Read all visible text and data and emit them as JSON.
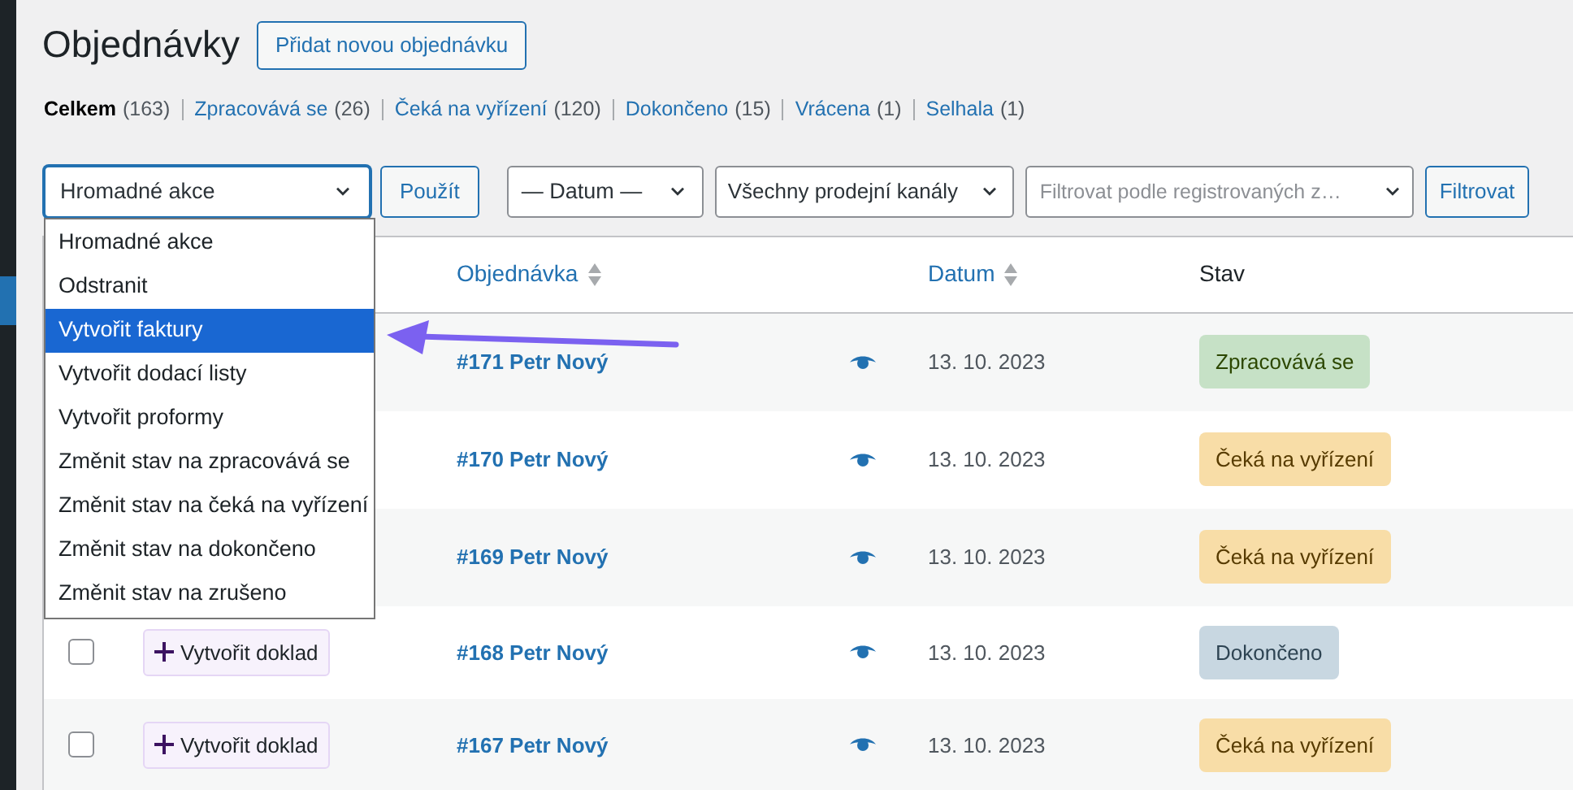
{
  "page": {
    "title": "Objednávky",
    "add_button": "Přidat novou objednávku"
  },
  "status_filters": [
    {
      "label": "Celkem",
      "count": "(163)",
      "selected": true
    },
    {
      "label": "Zpracovává se",
      "count": "(26)",
      "selected": false
    },
    {
      "label": "Čeká na vyřízení",
      "count": "(120)",
      "selected": false
    },
    {
      "label": "Dokončeno",
      "count": "(15)",
      "selected": false
    },
    {
      "label": "Vrácena",
      "count": "(1)",
      "selected": false
    },
    {
      "label": "Selhala",
      "count": "(1)",
      "selected": false
    }
  ],
  "toolbar": {
    "bulk_select": "Hromadné akce",
    "apply": "Použít",
    "date_select": "— Datum —",
    "channel_select": "Všechny prodejní kanály",
    "customer_filter": {
      "placeholder": "Filtrovat podle registrovaných z…"
    },
    "filter_button": "Filtrovat"
  },
  "bulk_menu": {
    "expanded": true,
    "items": [
      {
        "label": "Hromadné akce",
        "selected": false
      },
      {
        "label": "Odstranit",
        "selected": false
      },
      {
        "label": "Vytvořit faktury",
        "selected": true
      },
      {
        "label": "Vytvořit dodací listy",
        "selected": false
      },
      {
        "label": "Vytvořit proformy",
        "selected": false
      },
      {
        "label": "Změnit stav na zpracovává se",
        "selected": false
      },
      {
        "label": "Změnit stav na čeká na vyřízení",
        "selected": false
      },
      {
        "label": "Změnit stav na dokončeno",
        "selected": false
      },
      {
        "label": "Změnit stav na zrušeno",
        "selected": false
      }
    ]
  },
  "table": {
    "columns": [
      "Objednávka",
      "Datum",
      "Stav"
    ],
    "rows": [
      {
        "order": "#171 Petr Nový",
        "date": "13. 10. 2023",
        "status": "Zpracovává se",
        "kind": "processing"
      },
      {
        "order": "#170 Petr Nový",
        "date": "13. 10. 2023",
        "status": "Čeká na vyřízení",
        "kind": "pending"
      },
      {
        "order": "#169 Petr Nový",
        "date": "13. 10. 2023",
        "status": "Čeká na vyřízení",
        "kind": "pending"
      },
      {
        "checked": false,
        "action": "Vytvořit doklad",
        "order": "#168 Petr Nový",
        "date": "13. 10. 2023",
        "status": "Dokončeno",
        "kind": "completed"
      },
      {
        "checked": false,
        "action": "Vytvořit doklad",
        "order": "#167 Petr Nový",
        "date": "13. 10. 2023",
        "status": "Čeká na vyřízení",
        "kind": "pending"
      }
    ]
  }
}
